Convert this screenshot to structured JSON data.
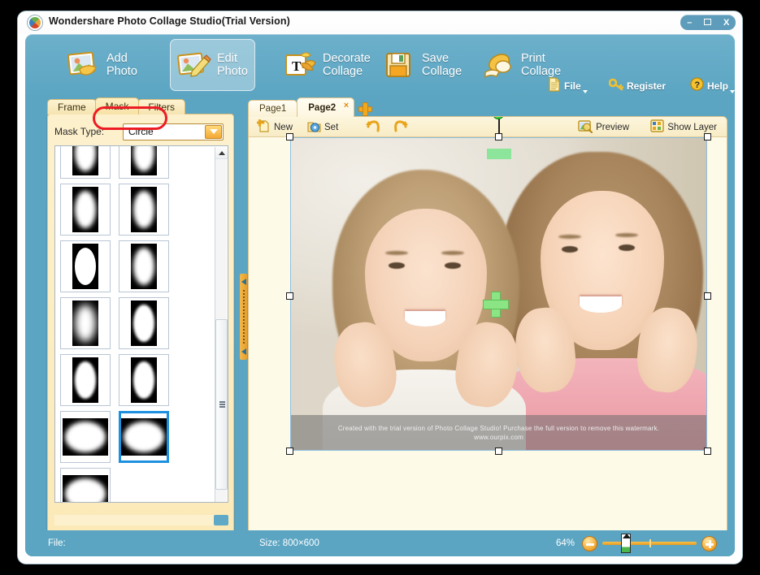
{
  "window": {
    "title": "Wondershare Photo Collage Studio(Trial Version)",
    "app_icon": "wondershare-logo-icon",
    "controls": {
      "minimize": "–",
      "maximize": "maximize-icon",
      "close": "X"
    }
  },
  "ribbon": {
    "buttons": [
      {
        "label": "Add\nPhoto",
        "icon": "add-photo-icon",
        "active": false
      },
      {
        "label": "Edit\nPhoto",
        "icon": "edit-photo-icon",
        "active": true
      },
      {
        "label": "Decorate\nCollage",
        "icon": "decorate-collage-icon",
        "active": false
      },
      {
        "label": "Save\nCollage",
        "icon": "save-collage-icon",
        "active": false
      },
      {
        "label": "Print\nCollage",
        "icon": "print-collage-icon",
        "active": false
      }
    ],
    "mini_buttons": [
      {
        "label": "File",
        "icon": "file-document-icon",
        "has_caret": true
      },
      {
        "label": "Register",
        "icon": "key-icon",
        "has_caret": false
      },
      {
        "label": "Help",
        "icon": "question-mark-icon",
        "has_caret": true
      }
    ]
  },
  "left_panel": {
    "tabs": [
      {
        "label": "Frame",
        "active": false
      },
      {
        "label": "Mask",
        "active": true
      },
      {
        "label": "Filters",
        "active": false
      }
    ],
    "highlight_ring_on": "Mask",
    "mask_type": {
      "label": "Mask Type:",
      "value": "Circle",
      "arrow_icon": "chevron-down-icon"
    },
    "thumbnails": [
      {
        "shape": "tall",
        "blur": "b2",
        "selected": false
      },
      {
        "shape": "tall",
        "blur": "b2",
        "selected": false
      },
      {
        "shape": "tall",
        "blur": "b2",
        "selected": false
      },
      {
        "shape": "tall",
        "blur": "b1",
        "selected": false
      },
      {
        "shape": "tall",
        "blur": "b0",
        "selected": false
      },
      {
        "shape": "tall",
        "blur": "b2",
        "selected": false
      },
      {
        "shape": "tall",
        "blur": "b3",
        "selected": false
      },
      {
        "shape": "tall",
        "blur": "b1",
        "selected": false
      },
      {
        "shape": "tall",
        "blur": "b1",
        "selected": false
      },
      {
        "shape": "tall",
        "blur": "b1",
        "selected": false
      },
      {
        "shape": "wide",
        "blur": "b2",
        "selected": false
      },
      {
        "shape": "wide",
        "blur": "b2",
        "selected": true
      },
      {
        "shape": "wide",
        "blur": "b2",
        "selected": false
      }
    ],
    "scroll": {
      "up_arrow_icon": "scroll-up-arrow-icon",
      "thumb_grip_icon": "scrollbar-grip-icon"
    },
    "collapse_handle_icon": "panel-collapse-handle-icon"
  },
  "pages": {
    "tabs": [
      {
        "label": "Page1",
        "active": false,
        "closable": false
      },
      {
        "label": "Page2",
        "active": true,
        "closable": true,
        "close_label": "×"
      }
    ],
    "add_tab_icon": "add-page-icon"
  },
  "canvas_toolbar": {
    "left_buttons": [
      {
        "label": "New",
        "icon": "new-page-icon"
      },
      {
        "label": "Set",
        "icon": "settings-gear-icon"
      },
      {
        "label": "",
        "icon": "undo-arrow-icon"
      },
      {
        "label": "",
        "icon": "redo-arrow-icon"
      }
    ],
    "right_buttons": [
      {
        "label": "Preview",
        "icon": "preview-magnifier-icon"
      },
      {
        "label": "Show Layer",
        "icon": "show-layer-icon"
      }
    ]
  },
  "canvas": {
    "watermark_line1": "Created with the trial version of Photo Collage Studio!  Purchase the full version to remove this watermark.",
    "watermark_line2": "www.ourpix.com",
    "selection": {
      "rotate_handle_icon": "rotate-handle-icon",
      "green_bar_icon": "mask-position-bar-icon",
      "move_cross_icon": "move-cross-icon",
      "handle_icon": "resize-handle-icon"
    }
  },
  "status_bar": {
    "file_label": "File:",
    "size_label": "Size:  800×600",
    "zoom_percent": "64%",
    "zoom_out_icon": "zoom-out-icon",
    "zoom_in_icon": "zoom-in-icon",
    "slider_icon": "zoom-slider-thumb"
  },
  "colors": {
    "ribbon_blue": "#5ba5c2",
    "panel_cream": "#fdf1cd",
    "accent_orange": "#f0a81e",
    "selection_blue": "#1e90e0",
    "highlight_red": "#ed1c24",
    "handle_green": "#17c417"
  }
}
